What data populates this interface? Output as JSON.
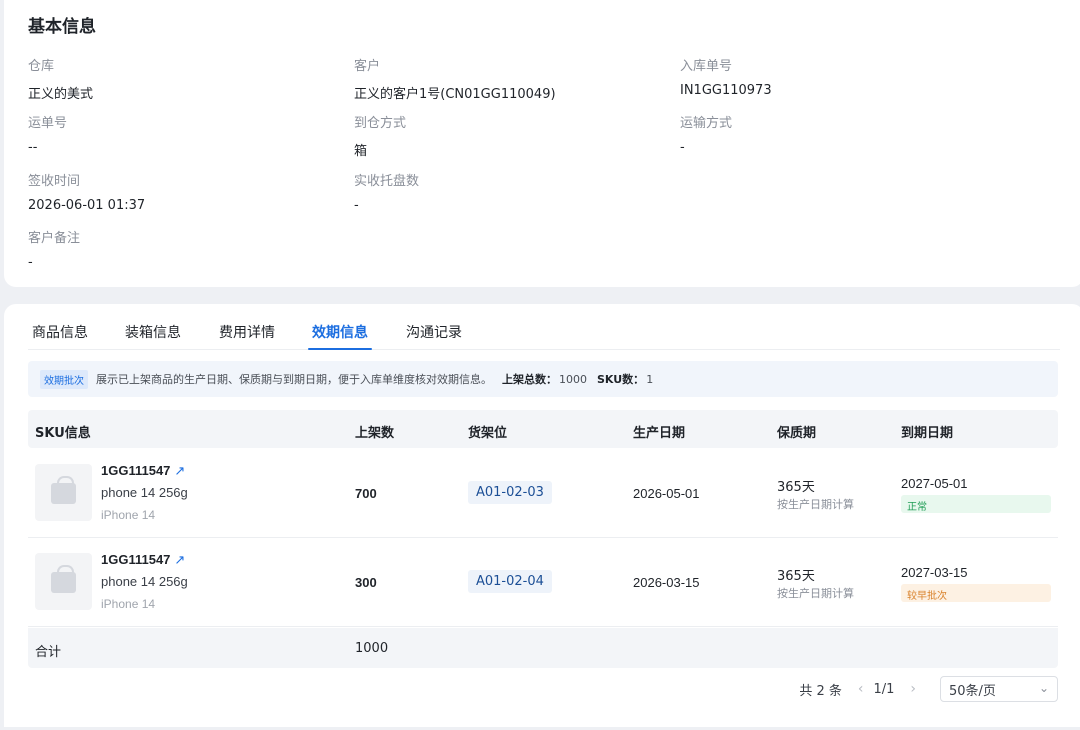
{
  "basic": {
    "title": "基本信息",
    "fields": [
      {
        "label": "仓库",
        "value": "正义的美式"
      },
      {
        "label": "客户",
        "value": "正义的客户1号(CN01GG110049)"
      },
      {
        "label": "入库单号",
        "value": "IN1GG110973"
      },
      {
        "label": "运单号",
        "value": "--"
      },
      {
        "label": "到仓方式",
        "value": "箱"
      },
      {
        "label": "运输方式",
        "value": "-"
      },
      {
        "label": "签收时间",
        "value": "2026-06-01 01:37"
      },
      {
        "label": "实收托盘数",
        "value": "-"
      },
      {
        "label": "客户备注",
        "value": "-"
      }
    ]
  },
  "tabs": [
    {
      "label": "商品信息",
      "active": false
    },
    {
      "label": "装箱信息",
      "active": false
    },
    {
      "label": "费用详情",
      "active": false
    },
    {
      "label": "效期信息",
      "active": true
    },
    {
      "label": "沟通记录",
      "active": false
    }
  ],
  "banner": {
    "tag": "效期批次",
    "text": "展示已上架商品的生产日期、保质期与到期日期，便于入库单维度核对效期信息。",
    "total_label": "上架总数：",
    "total_value": "1000",
    "sku_label": "SKU数：",
    "sku_value": "1"
  },
  "table": {
    "headers": [
      "SKU信息",
      "上架数",
      "货架位",
      "生产日期",
      "保质期",
      "到期日期"
    ],
    "rows": [
      {
        "sku_code": "1GG111547",
        "sku_name": "phone 14 256g",
        "sku_model": "iPhone 14",
        "qty": "700",
        "location": "A01-02-03",
        "production_date": "2026-05-01",
        "shelf_life": "365天",
        "shelf_life_note": "按生产日期计算",
        "expiry_date": "2027-05-01",
        "status": "正常"
      },
      {
        "sku_code": "1GG111547",
        "sku_name": "phone 14 256g",
        "sku_model": "iPhone 14",
        "qty": "300",
        "location": "A01-02-04",
        "production_date": "2026-03-15",
        "shelf_life": "365天",
        "shelf_life_note": "按生产日期计算",
        "expiry_date": "2027-03-15",
        "status": "较早批次"
      }
    ],
    "total": {
      "label": "合计",
      "value": "1000"
    }
  },
  "pager": {
    "summary": "共 2 条",
    "page": "1/1",
    "page_size": "50条/页"
  },
  "colors": {
    "accent": "#1c6ee0",
    "ok": "#1f9d55",
    "warn": "#d9822b"
  }
}
